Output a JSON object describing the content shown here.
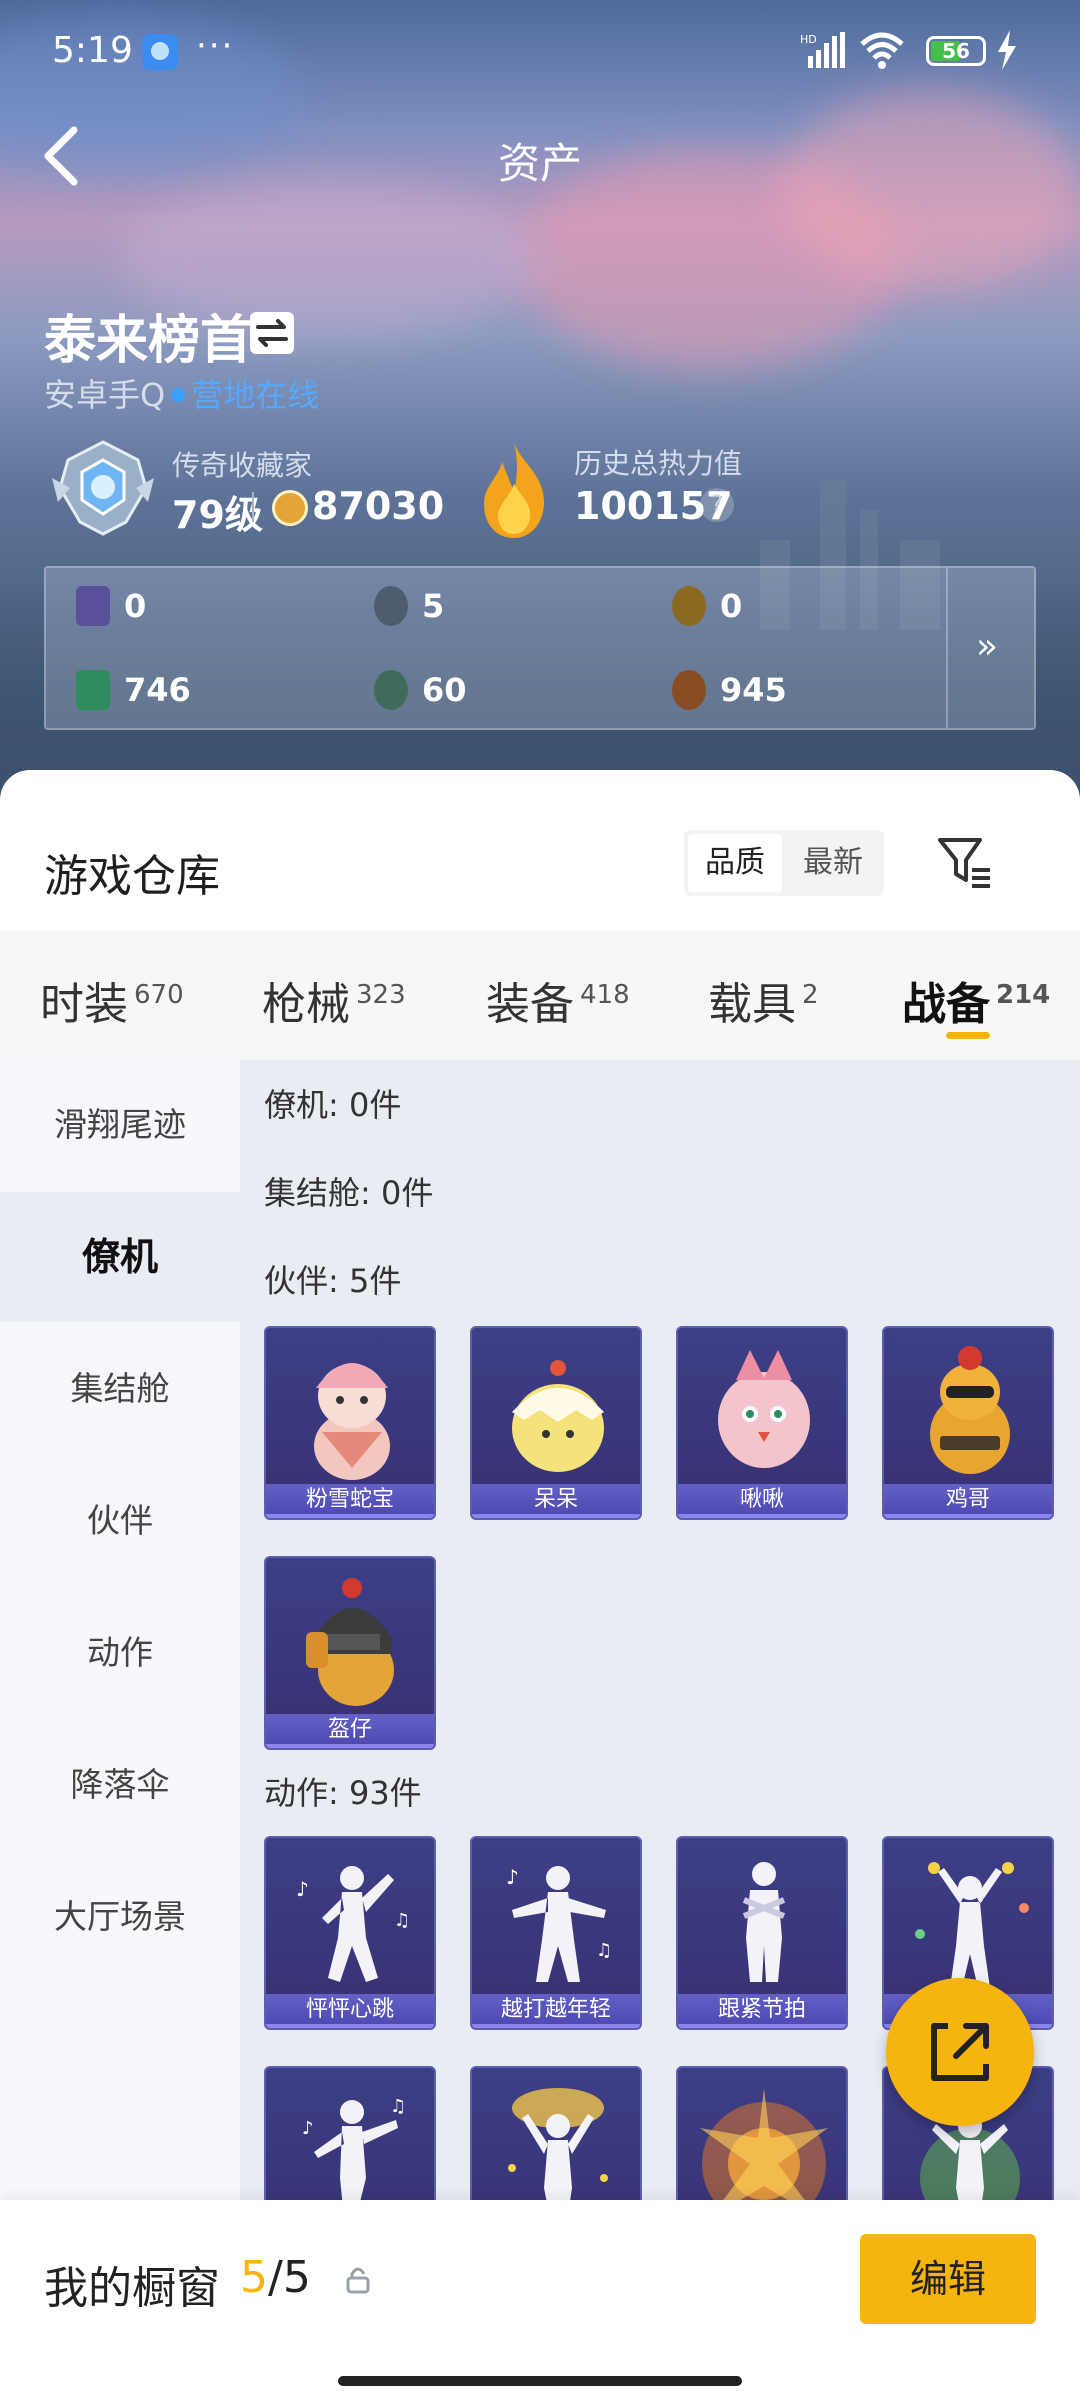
{
  "status_bar": {
    "time": "5:19",
    "more": "···",
    "battery": "56",
    "signal_label": "HD"
  },
  "header": {
    "title": "资产"
  },
  "profile": {
    "name": "泰来榜首",
    "account": "安卓手Q",
    "online": "营地在线",
    "rank_title": "传奇收藏家",
    "level": "79级",
    "coins": "87030",
    "heat_title": "历史总热力值",
    "heat_value": "100157",
    "help": "?"
  },
  "currencies": [
    {
      "value": "0",
      "icon": "card-icon",
      "color": "#5a4f9a"
    },
    {
      "value": "5",
      "icon": "coin-icon",
      "color": "#4d5d70"
    },
    {
      "value": "0",
      "icon": "gold-coin-icon",
      "color": "#8a6a20"
    },
    {
      "value": "746",
      "icon": "ticket-icon",
      "color": "#2e8c5e"
    },
    {
      "value": "60",
      "icon": "sphere-icon",
      "color": "#3f6c5a"
    },
    {
      "value": "945",
      "icon": "bronze-coin-icon",
      "color": "#8a4c22"
    }
  ],
  "currencies_more": "»",
  "warehouse": {
    "title": "游戏仓库",
    "sort_options": [
      "品质",
      "最新"
    ],
    "active_sort": "品质"
  },
  "tabs": [
    {
      "label": "时装",
      "count": "670"
    },
    {
      "label": "枪械",
      "count": "323"
    },
    {
      "label": "装备",
      "count": "418"
    },
    {
      "label": "载具",
      "count": "2"
    },
    {
      "label": "战备",
      "count": "214"
    }
  ],
  "active_tab": "战备",
  "sidebar": [
    "滑翔尾迹",
    "僚机",
    "集结舱",
    "伙伴",
    "动作",
    "降落伞",
    "大厅场景"
  ],
  "active_sidebar": "僚机",
  "sections": {
    "wingman": "僚机: 0件",
    "pod": "集结舱: 0件",
    "partner": "伙伴: 5件",
    "emote": "动作: 93件"
  },
  "partners": [
    "粉雪蛇宝",
    "呆呆",
    "啾啾",
    "鸡哥",
    "盔仔"
  ],
  "emotes": [
    "怦怦心跳",
    "越打越年轻",
    "跟紧节拍",
    ""
  ],
  "showcase": {
    "title": "我的橱窗",
    "used": "5",
    "sep": "/",
    "total": "5",
    "edit": "编辑"
  },
  "accent_color": "#f6b40f"
}
